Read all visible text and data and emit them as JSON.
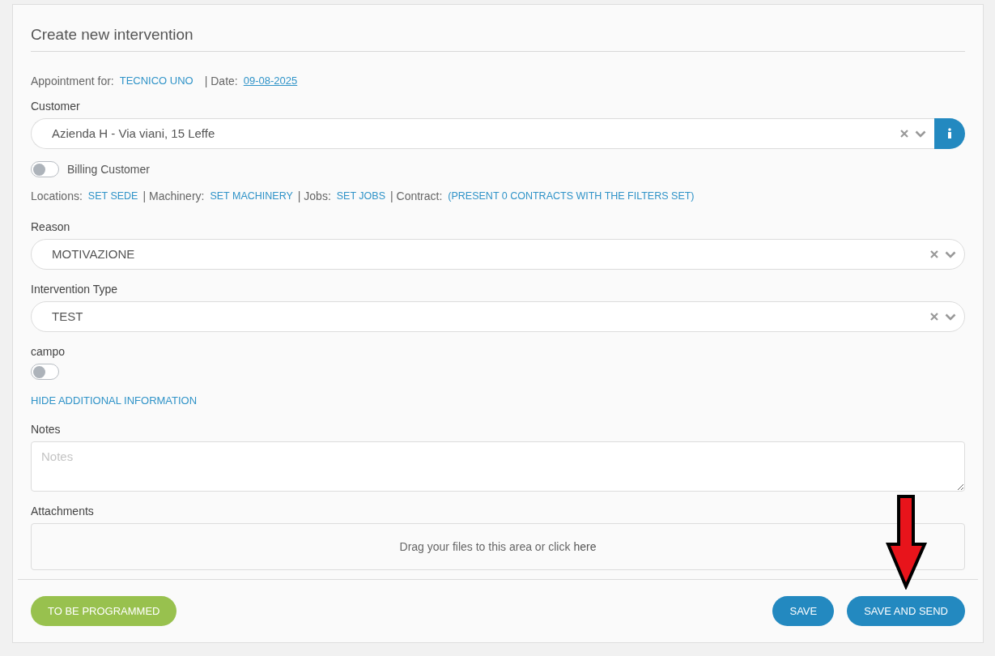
{
  "title": "Create new intervention",
  "appointment": {
    "label": "Appointment for:",
    "technician": "TECNICO UNO",
    "date_label": "| Date:",
    "date": "09-08-2025"
  },
  "customer": {
    "label": "Customer",
    "value": "Azienda H - Via viani, 15 Leffe"
  },
  "billing_customer": {
    "label": "Billing Customer",
    "on": false
  },
  "links_row": [
    {
      "label": "Locations:",
      "link": "SET SEDE"
    },
    {
      "label": "| Machinery:",
      "link": "SET MACHINERY"
    },
    {
      "label": "| Jobs:",
      "link": "SET JOBS"
    },
    {
      "label": "| Contract:",
      "link": "(PRESENT 0 CONTRACTS WITH THE FILTERS SET)"
    }
  ],
  "reason": {
    "label": "Reason",
    "value": "MOTIVAZIONE"
  },
  "intervention_type": {
    "label": "Intervention Type",
    "value": "TEST"
  },
  "campo": {
    "label": "campo",
    "on": false
  },
  "toggle_info_link": "HIDE ADDITIONAL INFORMATION",
  "notes": {
    "label": "Notes",
    "placeholder": "Notes"
  },
  "attachments": {
    "label": "Attachments",
    "text": "Drag your files to this area or click",
    "link": "here"
  },
  "buttons": [
    {
      "label": "TO BE PROGRAMMED",
      "kind": "status"
    },
    {
      "label": "SAVE",
      "kind": "primary"
    },
    {
      "label": "SAVE AND SEND",
      "kind": "primary"
    }
  ]
}
